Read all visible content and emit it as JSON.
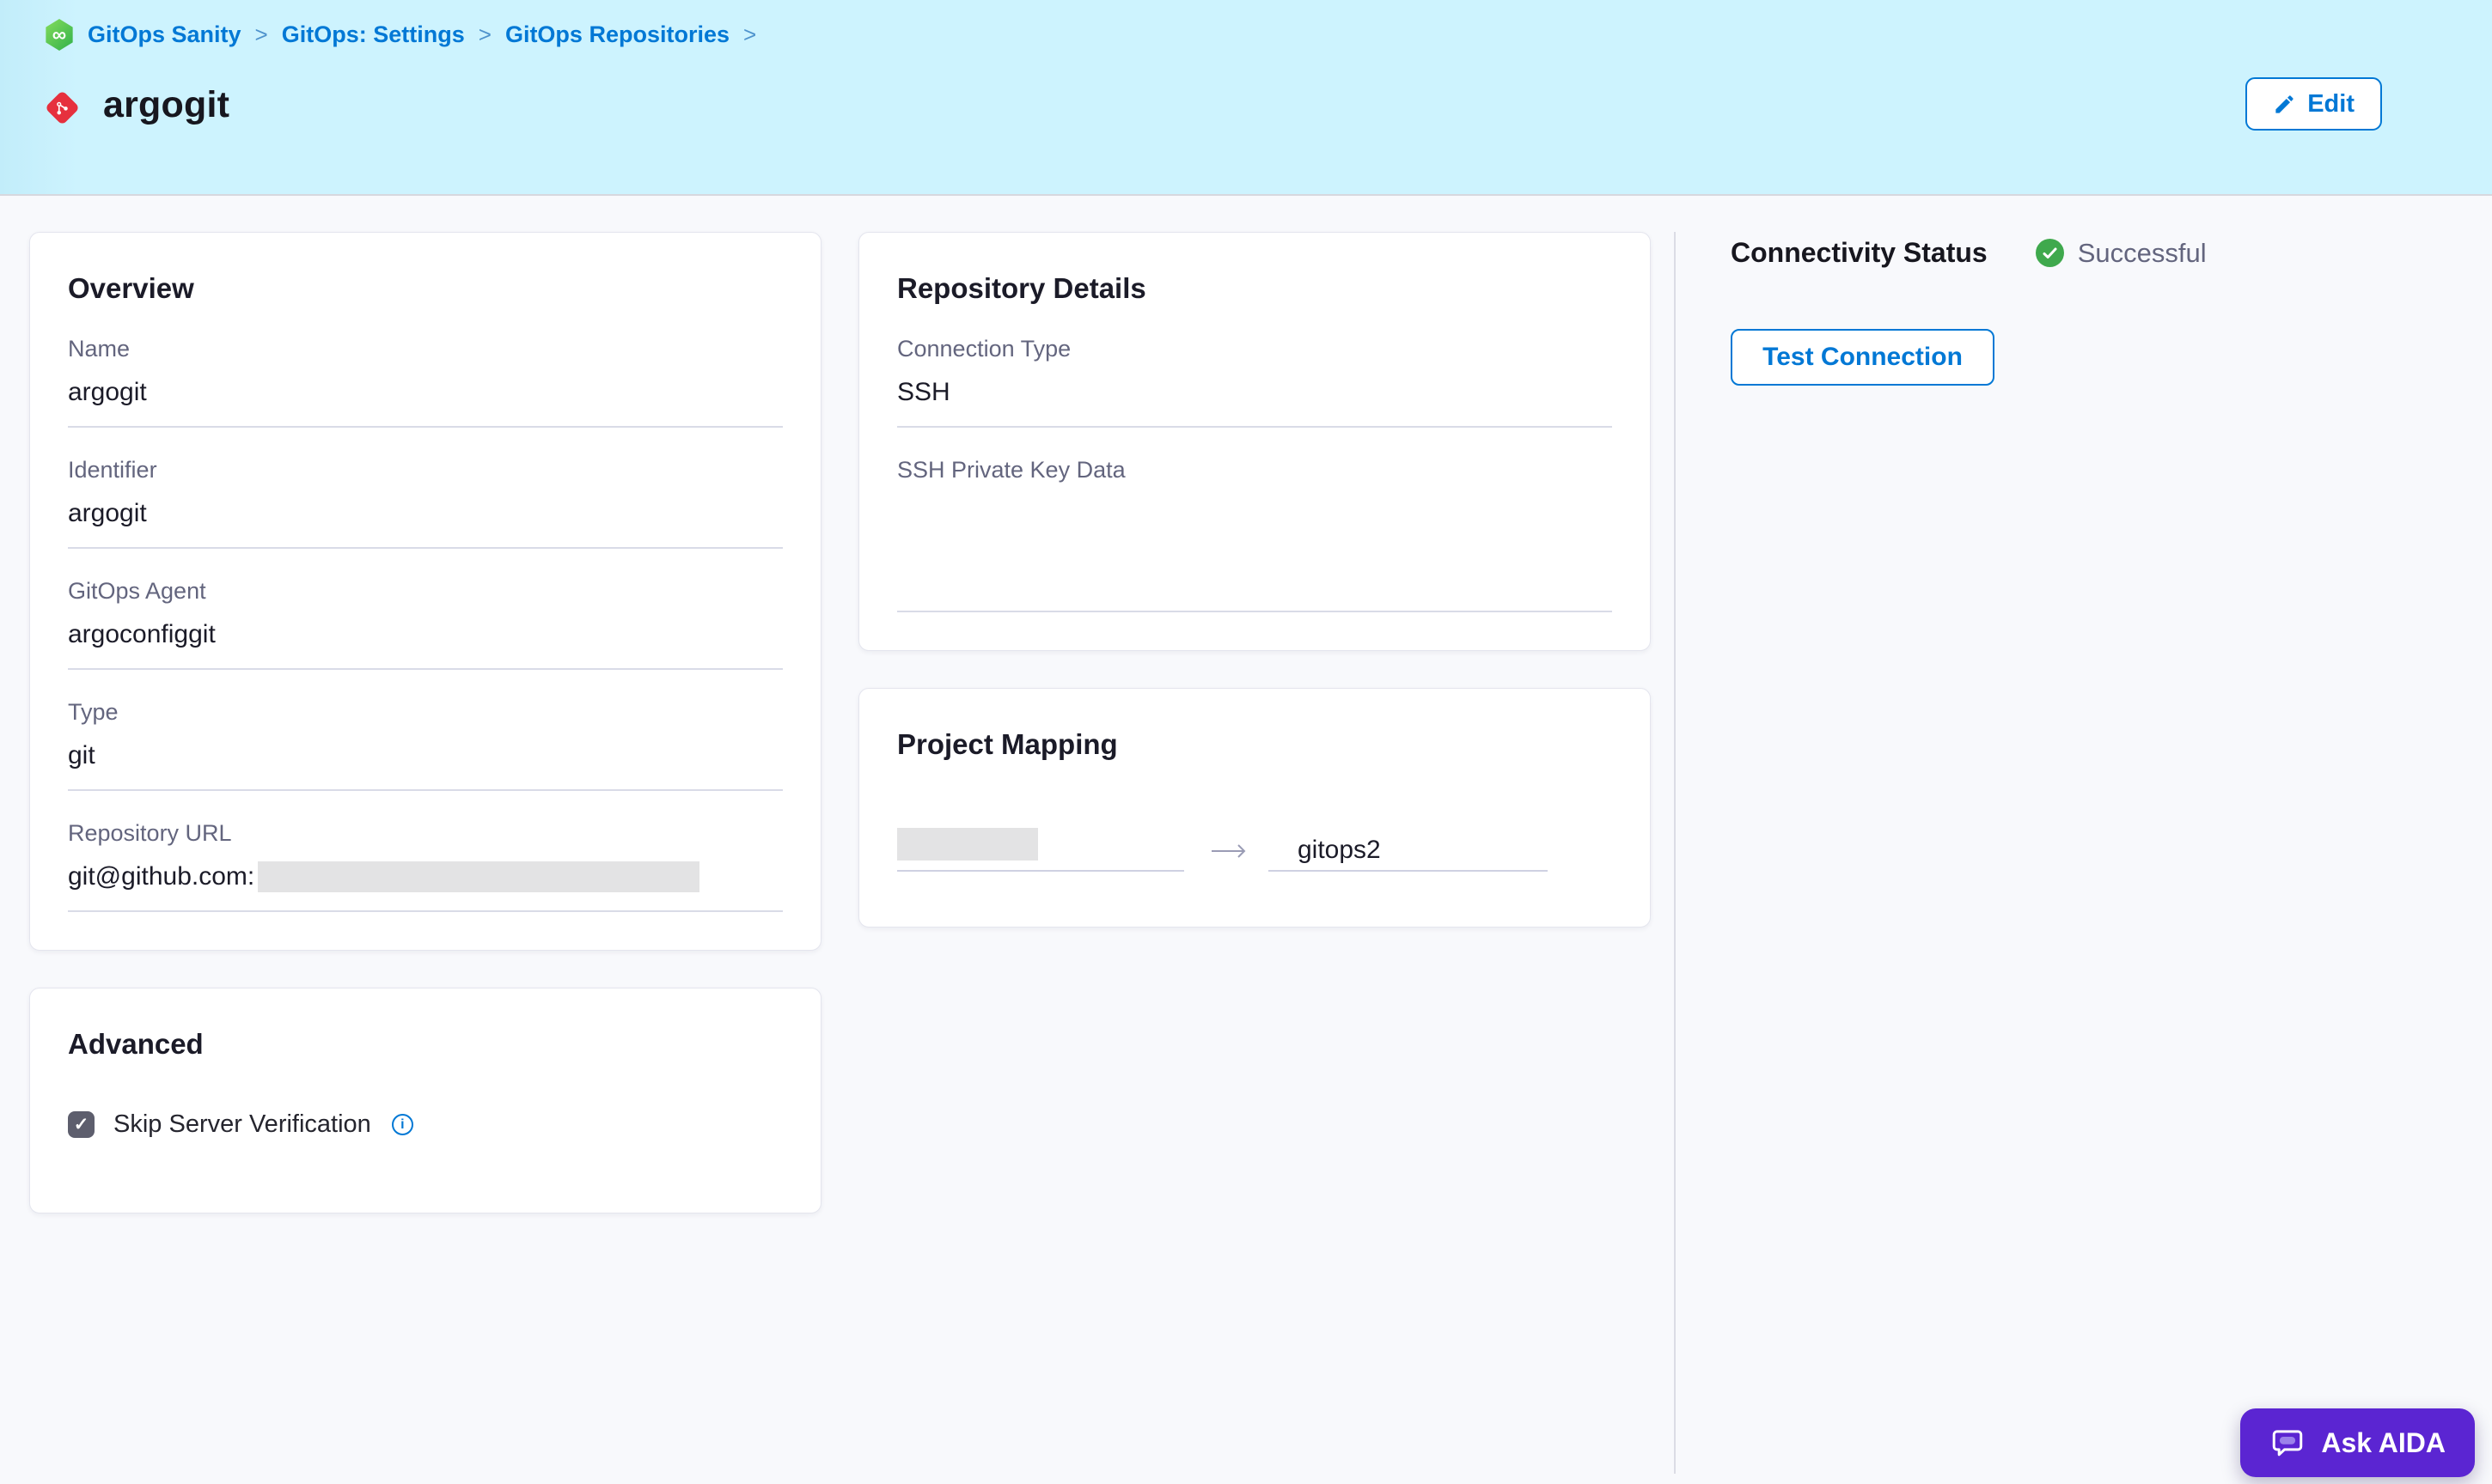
{
  "breadcrumb": {
    "separator": ">",
    "items": [
      "GitOps Sanity",
      "GitOps: Settings",
      "GitOps Repositories"
    ]
  },
  "header": {
    "title": "argogit",
    "edit_label": "Edit"
  },
  "overview": {
    "title": "Overview",
    "fields": [
      {
        "label": "Name",
        "value": "argogit"
      },
      {
        "label": "Identifier",
        "value": "argogit"
      },
      {
        "label": "GitOps Agent",
        "value": "argoconfiggit"
      },
      {
        "label": "Type",
        "value": "git"
      },
      {
        "label": "Repository URL",
        "value": "git@github.com:",
        "redacted_suffix": true
      }
    ]
  },
  "repository_details": {
    "title": "Repository Details",
    "fields": [
      {
        "label": "Connection Type",
        "value": "SSH"
      },
      {
        "label": "SSH Private Key Data",
        "value": ""
      }
    ]
  },
  "project_mapping": {
    "title": "Project Mapping",
    "source_redacted": true,
    "target": "gitops2"
  },
  "advanced": {
    "title": "Advanced",
    "checkbox_label": "Skip Server Verification",
    "checked": true,
    "info_glyph": "i"
  },
  "connectivity": {
    "title": "Connectivity Status",
    "status_label": "Successful",
    "test_button_label": "Test Connection"
  },
  "aida": {
    "button_label": "Ask AIDA"
  },
  "colors": {
    "accent_blue": "#0278d5",
    "success_green": "#3fa94d",
    "aida_purple": "#5b25d2",
    "header_cyan": "#cdf3fe",
    "git_red": "#e6303e",
    "gitops_green": "#2fb04a"
  }
}
